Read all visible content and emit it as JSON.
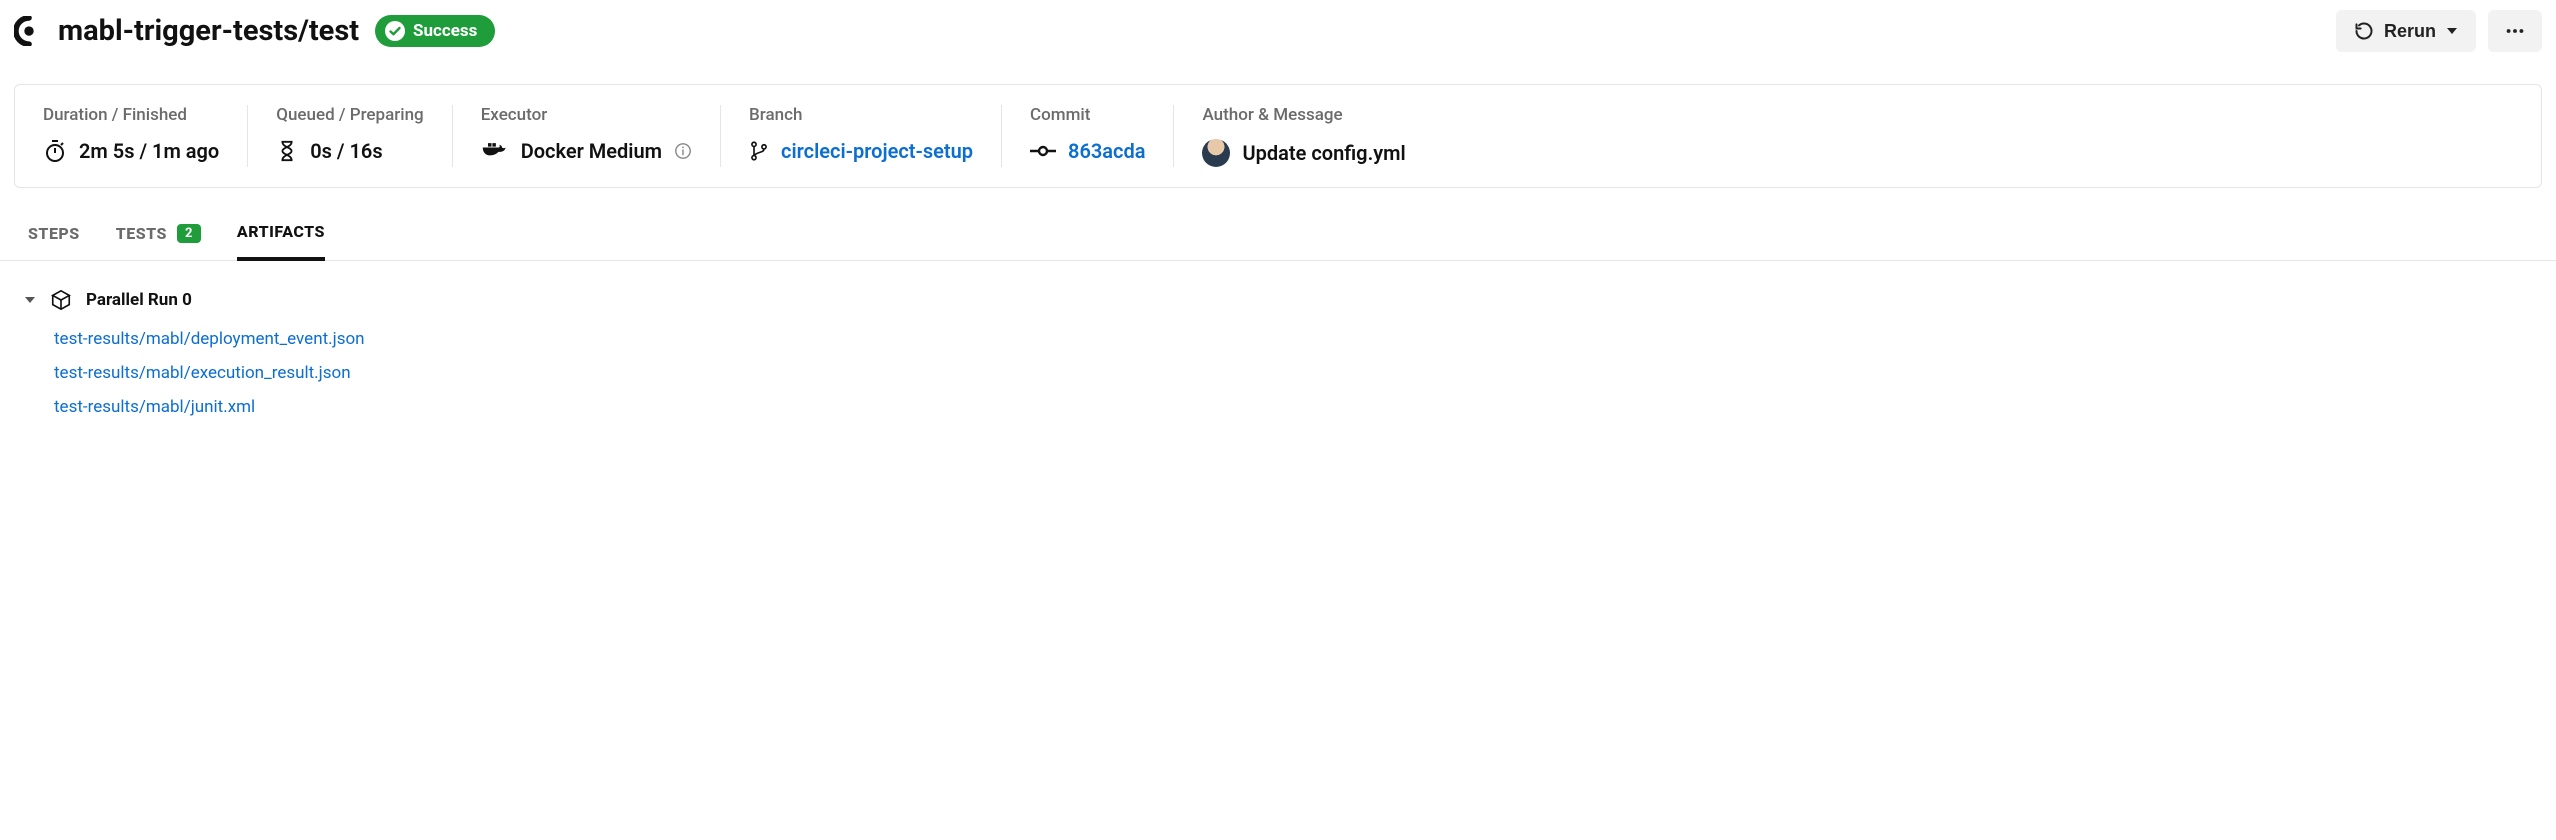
{
  "header": {
    "title": "mabl-trigger-tests/test",
    "status_label": "Success",
    "rerun_label": "Rerun"
  },
  "metrics": {
    "duration_label": "Duration / Finished",
    "duration_value": "2m 5s / 1m ago",
    "queued_label": "Queued / Preparing",
    "queued_value": "0s / 16s",
    "executor_label": "Executor",
    "executor_value": "Docker Medium",
    "branch_label": "Branch",
    "branch_value": "circleci-project-setup",
    "commit_label": "Commit",
    "commit_value": "863acda",
    "author_label": "Author & Message",
    "author_message": "Update config.yml"
  },
  "tabs": {
    "steps": "STEPS",
    "tests": "TESTS",
    "tests_count": "2",
    "artifacts": "ARTIFACTS"
  },
  "artifacts": {
    "group_title": "Parallel Run 0",
    "items": [
      "test-results/mabl/deployment_event.json",
      "test-results/mabl/execution_result.json",
      "test-results/mabl/junit.xml"
    ]
  }
}
